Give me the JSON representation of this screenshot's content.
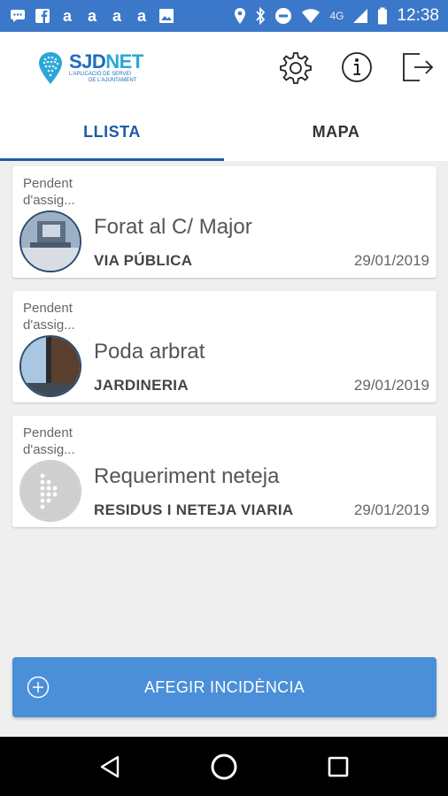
{
  "status_bar": {
    "time": "12:38",
    "network": "4G",
    "left_icons": [
      "message-icon",
      "facebook-icon",
      "a-icon",
      "a-icon",
      "a-icon",
      "a-icon",
      "image-icon"
    ],
    "right_icons": [
      "location-icon",
      "bluetooth-icon",
      "dnd-icon",
      "wifi-icon",
      "signal-icon",
      "battery-icon"
    ]
  },
  "header": {
    "logo_title_main": "SJD",
    "logo_title_accent": "NET",
    "logo_subtitle_line1": "L'APLICACIÓ DE SERVEI",
    "logo_subtitle_line2": "DE L'AJUNTAMENT",
    "icons": [
      "settings-icon",
      "info-icon",
      "logout-icon"
    ]
  },
  "tabs": [
    {
      "label": "LLISTA",
      "active": true
    },
    {
      "label": "MAPA",
      "active": false
    }
  ],
  "incidents": [
    {
      "status": "Pendent d'assig...",
      "title": "Forat al C/ Major",
      "category": "VIA PÚBLICA",
      "date": "29/01/2019"
    },
    {
      "status": "Pendent d'assig...",
      "title": "Poda arbrat",
      "category": "JARDINERIA",
      "date": "29/01/2019"
    },
    {
      "status": "Pendent d'assig...",
      "title": "Requeriment neteja",
      "category": "RESIDUS I NETEJA VIARIA",
      "date": "29/01/2019"
    }
  ],
  "add_button": {
    "label": "AFEGIR INCIDÈNCIA",
    "icon": "plus-circle-icon"
  },
  "nav_bar": {
    "icons": [
      "back-icon",
      "home-icon",
      "recents-icon"
    ]
  },
  "colors": {
    "status_bar": "#3b78c9",
    "accent": "#1e5aa8",
    "button": "#4a8fd8"
  }
}
